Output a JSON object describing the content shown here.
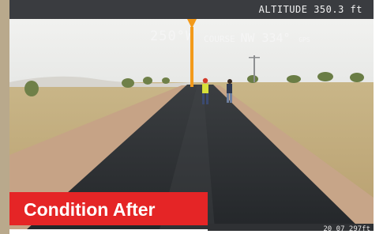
{
  "hud": {
    "altitude": "ALTITUDE 350.3 ft",
    "heading": "250°W",
    "course_label": "COURSE",
    "course_value": "NW 334°",
    "course_source": "GPS",
    "bottom_readout": "20 07 297ft"
  },
  "banner": {
    "text": "Condition After",
    "color": "#e52526"
  },
  "colors": {
    "pointer": "#f39a1a",
    "hud_bar": "#3a3c40",
    "road": "#2b2e31"
  }
}
